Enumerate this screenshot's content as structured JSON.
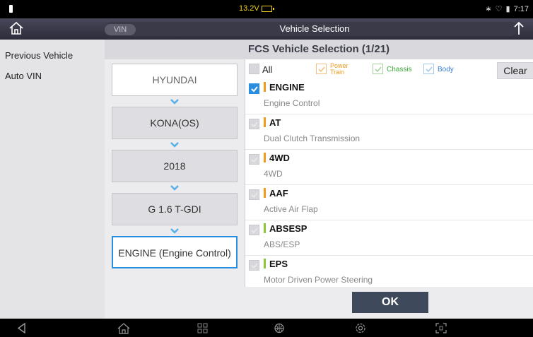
{
  "status": {
    "voltage": "13.2V",
    "time": "7:17"
  },
  "header": {
    "vin_label": "VIN",
    "title": "Vehicle Selection"
  },
  "sidebar": {
    "items": [
      {
        "label": "Previous Vehicle"
      },
      {
        "label": "Auto VIN"
      }
    ]
  },
  "main": {
    "title": "FCS Vehicle Selection (1/21)"
  },
  "flow": {
    "steps": [
      {
        "label": "HYUNDAI"
      },
      {
        "label": "KONA(OS)"
      },
      {
        "label": "2018"
      },
      {
        "label": "G 1.6 T-GDI"
      },
      {
        "label": "ENGINE (Engine Control)"
      }
    ]
  },
  "filters": {
    "all_label": "All",
    "powertrain_label": "Power Train",
    "chassis_label": "Chassis",
    "body_label": "Body",
    "clear_label": "Clear",
    "colors": {
      "powertrain": "#f09a20",
      "chassis": "#3aa83a",
      "body": "#3a7ad8"
    }
  },
  "systems": [
    {
      "code": "ENGINE",
      "desc": "Engine Control",
      "checked": true,
      "color": "#f09a20"
    },
    {
      "code": "AT",
      "desc": "Dual Clutch Transmission",
      "checked": false,
      "color": "#f09a20"
    },
    {
      "code": "4WD",
      "desc": "4WD",
      "checked": false,
      "color": "#f09a20"
    },
    {
      "code": "AAF",
      "desc": "Active Air Flap",
      "checked": false,
      "color": "#f09a20"
    },
    {
      "code": "ABSESP",
      "desc": "ABS/ESP",
      "checked": false,
      "color": "#8cc63f"
    },
    {
      "code": "EPS",
      "desc": "Motor Driven Power Steering",
      "checked": false,
      "color": "#8cc63f"
    }
  ],
  "actions": {
    "ok_label": "OK"
  },
  "accent": "#2a8ee0"
}
